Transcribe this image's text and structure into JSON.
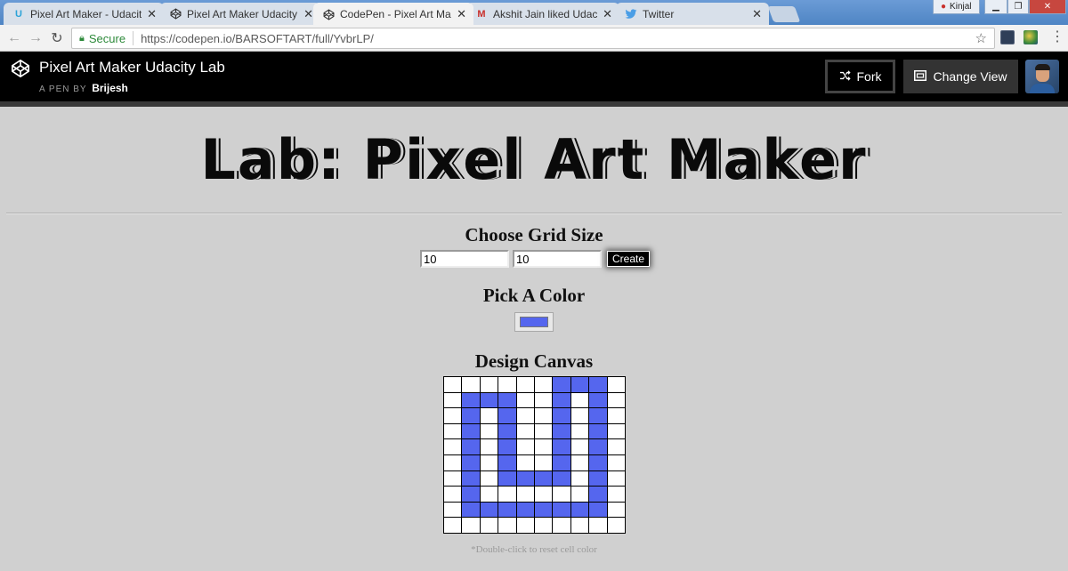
{
  "browser": {
    "tabs": [
      {
        "title": "Pixel Art Maker - Udacity",
        "favicon": "udacity-icon",
        "active": false
      },
      {
        "title": "Pixel Art Maker Udacity L",
        "favicon": "codepen-icon",
        "active": false
      },
      {
        "title": "CodePen - Pixel Art Make",
        "favicon": "codepen-icon",
        "active": true
      },
      {
        "title": "Akshit Jain liked Udacity I",
        "favicon": "gmail-icon",
        "active": false
      },
      {
        "title": "Twitter",
        "favicon": "twitter-icon",
        "active": false
      }
    ],
    "user_name": "Kinjal",
    "secure_label": "Secure",
    "url": "https://codepen.io/BARSOFTART/full/YvbrLP/"
  },
  "codepen": {
    "title": "Pixel Art Maker Udacity Lab",
    "byline": "A PEN BY",
    "author": "Brijesh",
    "fork_label": "Fork",
    "change_view_label": "Change View"
  },
  "page": {
    "title": "Lab: Pixel Art Maker",
    "grid_heading": "Choose Grid Size",
    "height_value": "10",
    "width_value": "10",
    "create_label": "Create",
    "color_heading": "Pick A Color",
    "selected_color": "#5566ee",
    "canvas_heading": "Design Canvas",
    "hint": "*Double-click to reset cell color"
  },
  "canvas": {
    "rows": 10,
    "cols": 10,
    "fill_color": "#5566ee",
    "cells": [
      [
        0,
        0,
        0,
        0,
        0,
        0,
        1,
        1,
        1,
        0
      ],
      [
        0,
        1,
        1,
        1,
        0,
        0,
        1,
        0,
        1,
        0
      ],
      [
        0,
        1,
        0,
        1,
        0,
        0,
        1,
        0,
        1,
        0
      ],
      [
        0,
        1,
        0,
        1,
        0,
        0,
        1,
        0,
        1,
        0
      ],
      [
        0,
        1,
        0,
        1,
        0,
        0,
        1,
        0,
        1,
        0
      ],
      [
        0,
        1,
        0,
        1,
        0,
        0,
        1,
        0,
        1,
        0
      ],
      [
        0,
        1,
        0,
        1,
        1,
        1,
        1,
        0,
        1,
        0
      ],
      [
        0,
        1,
        0,
        0,
        0,
        0,
        0,
        0,
        1,
        0
      ],
      [
        0,
        1,
        1,
        1,
        1,
        1,
        1,
        1,
        1,
        0
      ],
      [
        0,
        0,
        0,
        0,
        0,
        0,
        0,
        0,
        0,
        0
      ]
    ]
  }
}
